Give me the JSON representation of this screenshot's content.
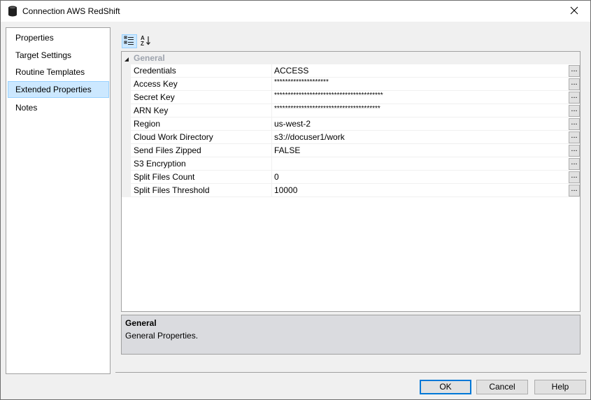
{
  "window": {
    "title": "Connection AWS RedShift"
  },
  "nav": {
    "items": [
      {
        "label": "Properties"
      },
      {
        "label": "Target Settings"
      },
      {
        "label": "Routine Templates"
      },
      {
        "label": "Extended Properties",
        "selected": true
      },
      {
        "label": "Notes"
      }
    ]
  },
  "toolbar": {
    "categorized_icon": "categorized-view-icon",
    "alphabetical_icon": "sort-az-icon"
  },
  "grid": {
    "category": "General",
    "properties": [
      {
        "name": "Credentials",
        "value": "ACCESS"
      },
      {
        "name": "Access Key",
        "value": "********************"
      },
      {
        "name": "Secret Key",
        "value": "****************************************"
      },
      {
        "name": "ARN Key",
        "value": "***************************************"
      },
      {
        "name": "Region",
        "value": "us-west-2"
      },
      {
        "name": "Cloud Work Directory",
        "value": "s3://docuser1/work"
      },
      {
        "name": "Send Files Zipped",
        "value": "FALSE"
      },
      {
        "name": "S3 Encryption",
        "value": ""
      },
      {
        "name": "Split Files Count",
        "value": "0"
      },
      {
        "name": "Split Files Threshold",
        "value": "10000"
      }
    ],
    "ellipsis_label": "..."
  },
  "description": {
    "title": "General",
    "text": "General Properties."
  },
  "buttons": {
    "ok": "OK",
    "cancel": "Cancel",
    "help": "Help"
  },
  "colors": {
    "selection_bg": "#cce8ff",
    "selection_border": "#99d1ff",
    "default_button_border": "#0078d7",
    "category_text": "#9da3ad"
  }
}
